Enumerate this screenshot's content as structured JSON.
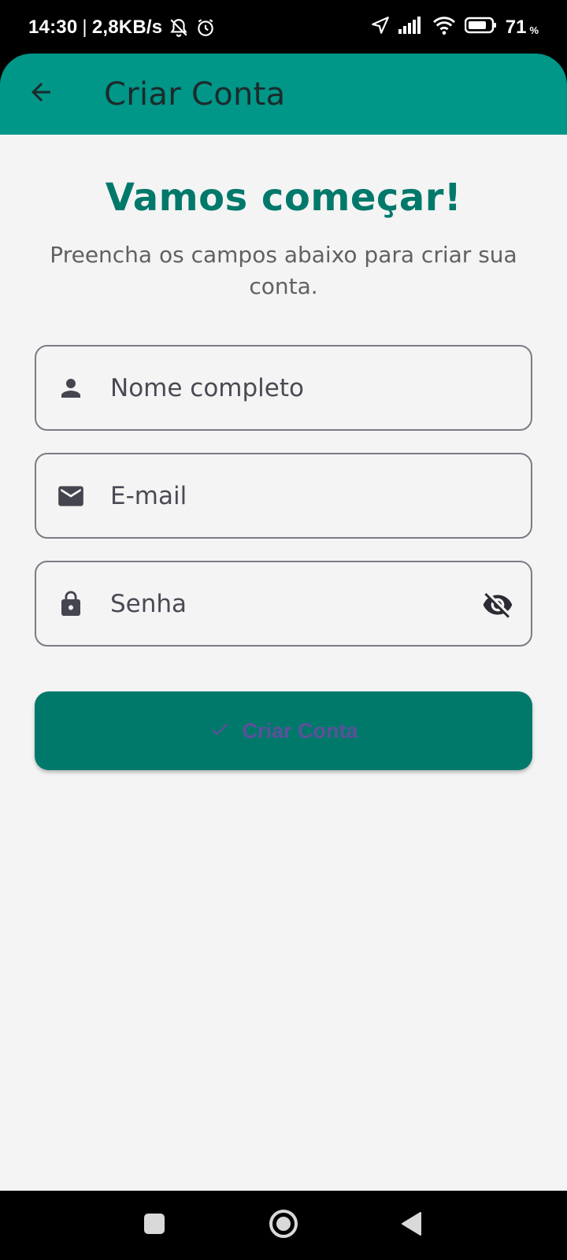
{
  "status_bar": {
    "time": "14:30",
    "separator": "|",
    "network_speed": "2,8KB/s",
    "battery_level": "71",
    "battery_unit": "%",
    "icons": [
      "bell-off-icon",
      "alarm-icon",
      "location-arrow-icon",
      "signal-icon",
      "wifi-icon",
      "battery-icon"
    ]
  },
  "app_bar": {
    "title": "Criar Conta",
    "back_icon": "arrow-left-icon",
    "color": "#009688"
  },
  "form": {
    "headline": "Vamos começar!",
    "subtitle": "Preencha os campos abaixo para criar sua conta.",
    "fields": [
      {
        "placeholder": "Nome completo",
        "icon": "person-icon"
      },
      {
        "placeholder": "E-mail",
        "icon": "email-icon"
      },
      {
        "placeholder": "Senha",
        "icon": "lock-icon",
        "trailing_icon": "visibility-off-icon"
      }
    ],
    "submit": {
      "label": "Criar Conta",
      "icon": "check-icon",
      "color": "#00796b",
      "label_color": "#5e4f9a"
    }
  },
  "nav_bar": {
    "buttons": [
      "recents-icon",
      "home-icon",
      "back-icon"
    ]
  }
}
